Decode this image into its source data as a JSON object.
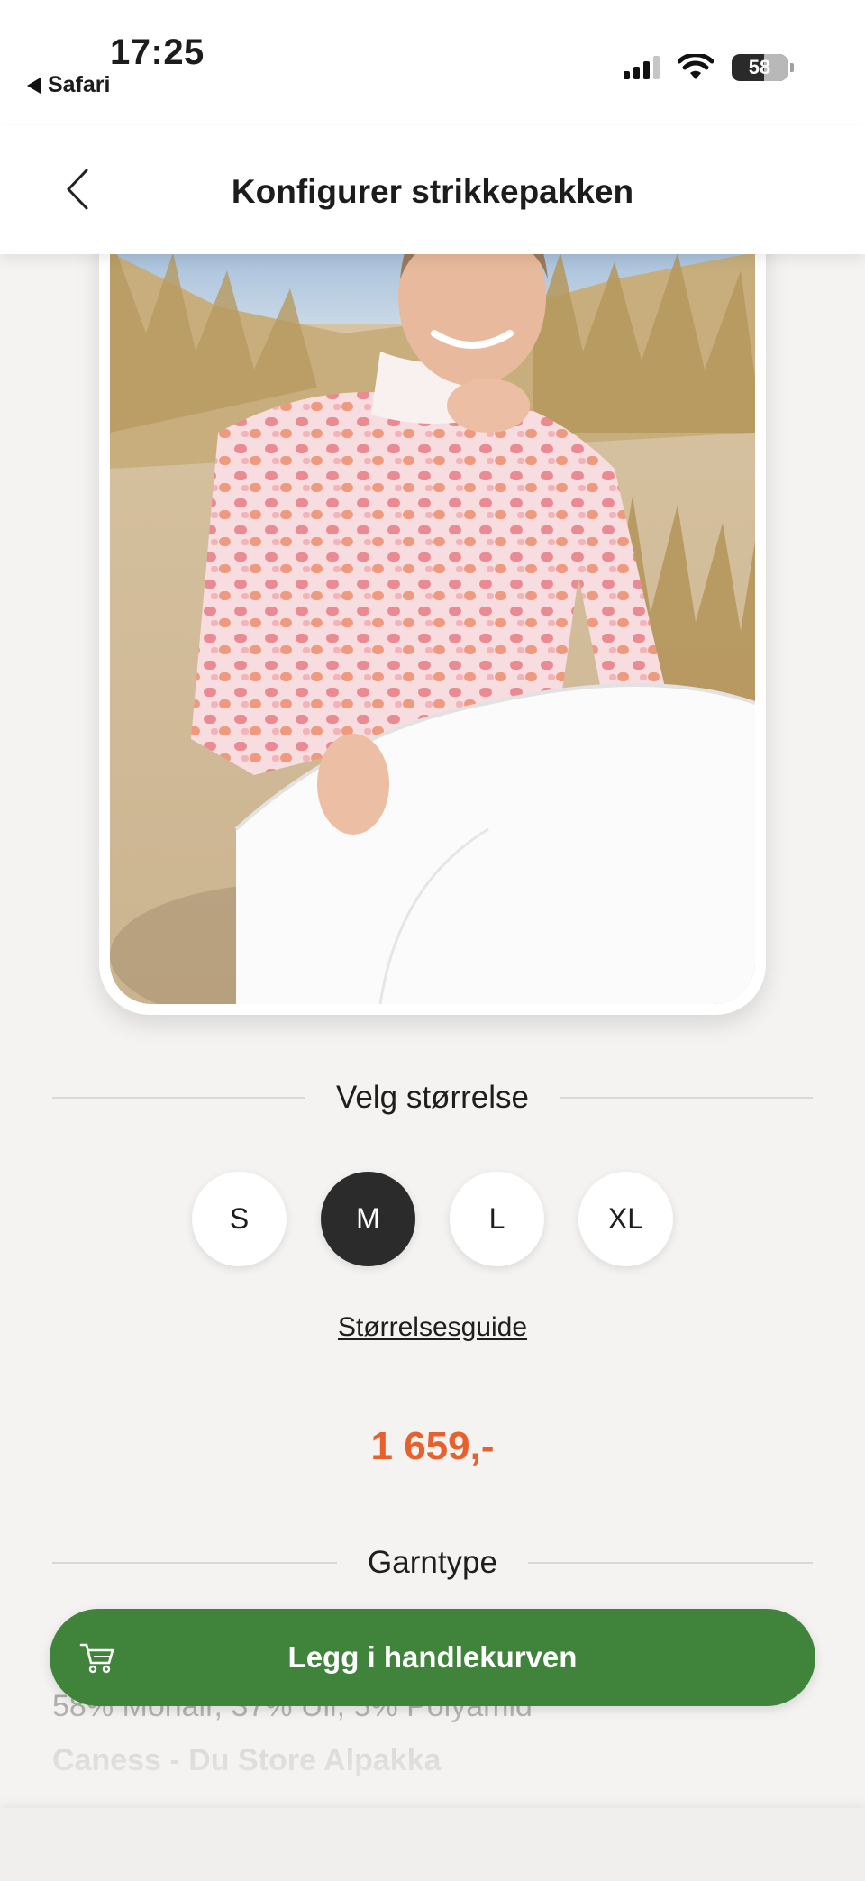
{
  "status_bar": {
    "time": "17:25",
    "back_app": "Safari",
    "battery": "58"
  },
  "nav": {
    "title": "Konfigurer strikkepakken"
  },
  "size_section": {
    "title": "Velg størrelse",
    "options": [
      "S",
      "M",
      "L",
      "XL"
    ],
    "selected": "M",
    "guide_link": "Størrelsesguide"
  },
  "price": {
    "value": "1 659,-",
    "color": "#e8612c"
  },
  "yarn_section": {
    "title": "Garntype",
    "composition": "58% Mohair, 37% Ull, 5% Polyamid",
    "name": "Caness - Du Store Alpakka"
  },
  "cart_button": {
    "label": "Legg i handlekurven",
    "color": "#3f843a",
    "icon": "cart-icon"
  }
}
